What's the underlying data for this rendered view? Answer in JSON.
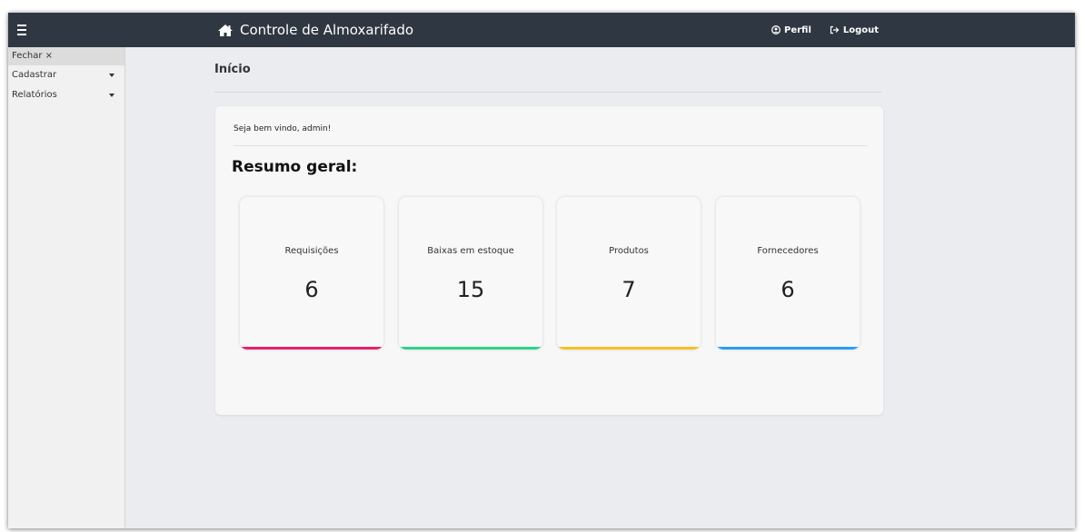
{
  "header": {
    "menu_icon": "hamburger-icon",
    "brand_icon": "home-icon",
    "title": "Controle de Almoxarifado",
    "profile_icon": "user-circle-icon",
    "profile_label": "Perfil",
    "logout_icon": "sign-out-icon",
    "logout_label": "Logout",
    "bg_color": "#2f3742"
  },
  "sidebar": {
    "close_label": "Fechar ×",
    "items": [
      {
        "label": "Cadastrar",
        "icon": "caret-down-icon"
      },
      {
        "label": "Relatórios",
        "icon": "caret-down-icon"
      }
    ]
  },
  "main": {
    "page_title": "Início",
    "welcome": "Seja bem vindo, admin!",
    "summary_title": "Resumo geral:",
    "cards": [
      {
        "label": "Requisições",
        "value": "6",
        "accent": "#e8206b"
      },
      {
        "label": "Baixas em estoque",
        "value": "15",
        "accent": "#2ad488"
      },
      {
        "label": "Produtos",
        "value": "7",
        "accent": "#f5c124"
      },
      {
        "label": "Fornecedores",
        "value": "6",
        "accent": "#2a9df4"
      }
    ]
  }
}
